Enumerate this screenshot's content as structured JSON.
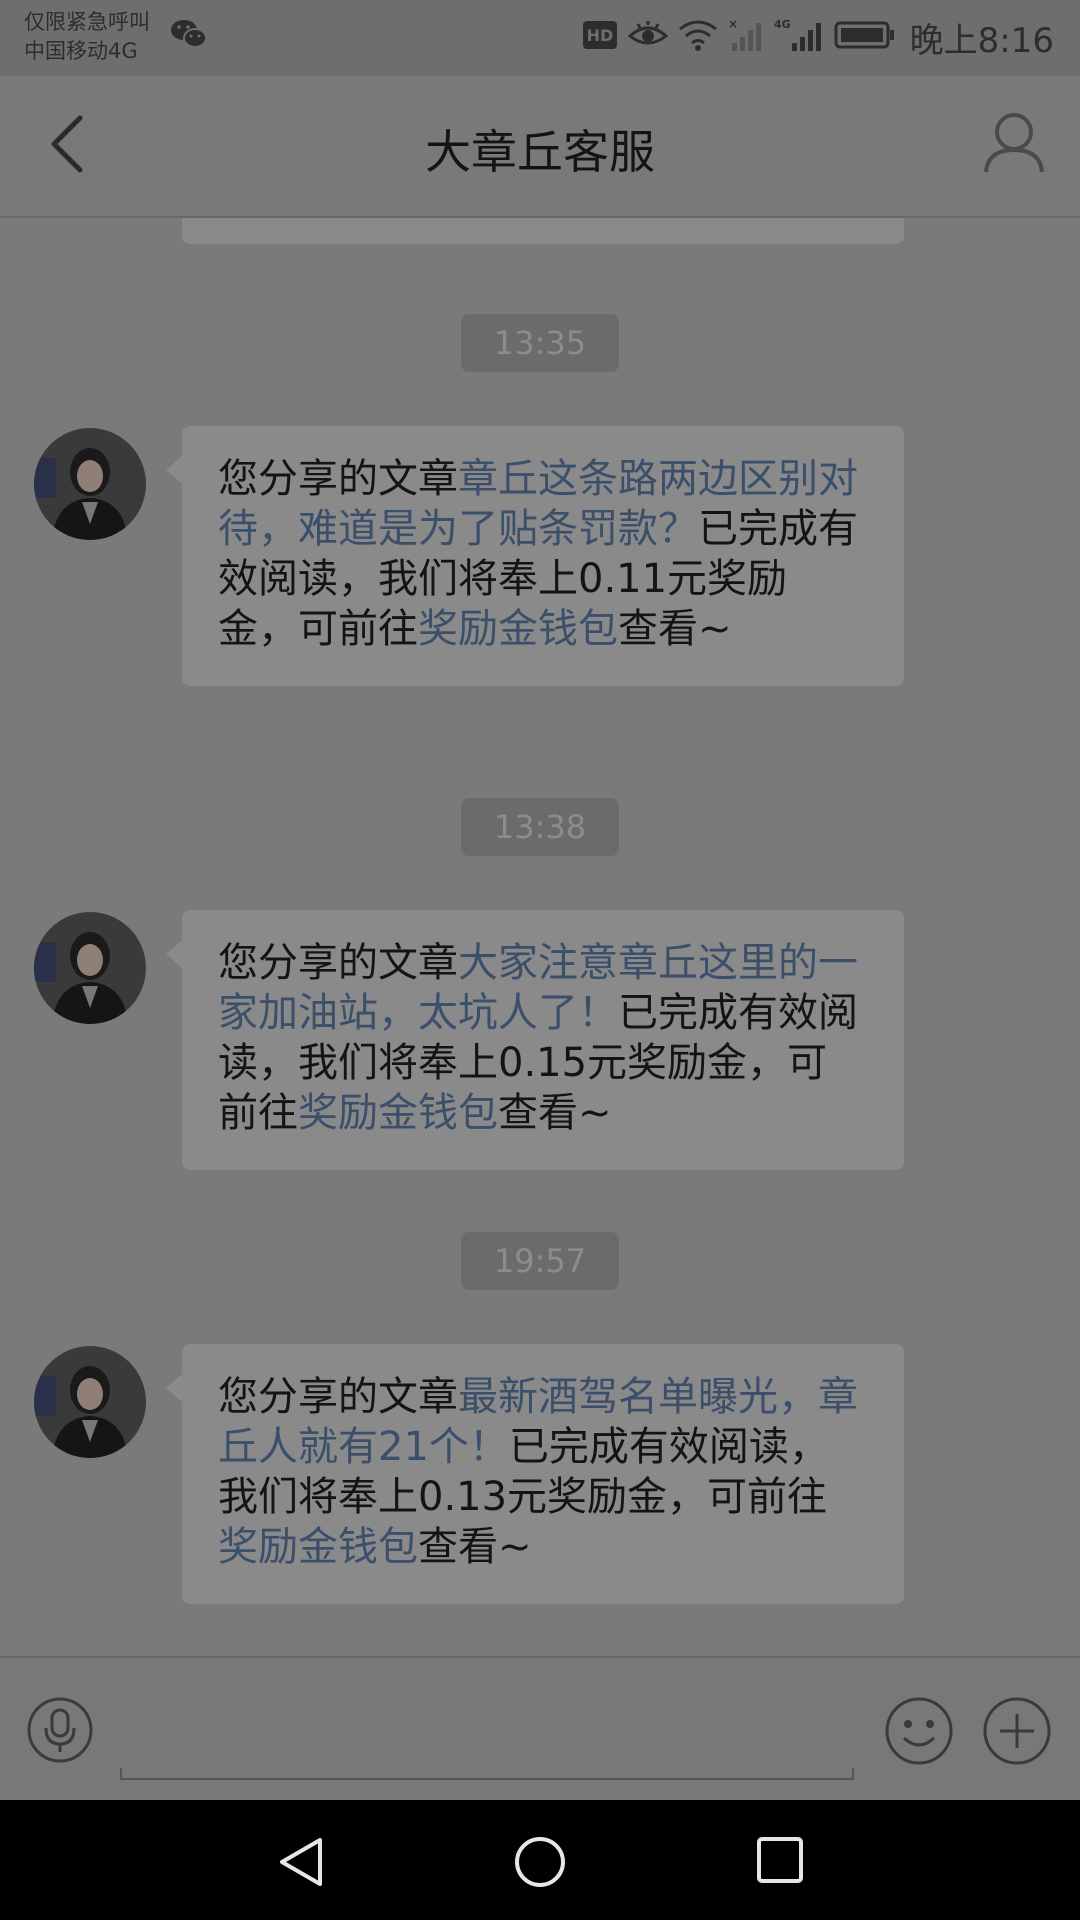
{
  "status_bar": {
    "carrier_line1": "仅限紧急呼叫",
    "carrier_line2": "中国移动4G",
    "hd_badge": "HD",
    "network_label": "4G",
    "time": "晚上8:16",
    "icons": [
      "wechat-icon",
      "hd-icon",
      "eye-icon",
      "wifi-icon",
      "no-signal-icon",
      "signal-icon",
      "battery-icon"
    ]
  },
  "nav": {
    "title": "大章丘客服",
    "back_icon": "chevron-left-icon",
    "profile_icon": "user-icon"
  },
  "messages": [
    {
      "time": "13:35",
      "parts": [
        {
          "text": "您分享的文章",
          "link": false
        },
        {
          "text": "章丘这条路两边区别对待，难道是为了贴条罚款？",
          "link": true
        },
        {
          "text": "已完成有效阅读，我们将奉上0.11元奖励金，可前往",
          "link": false
        },
        {
          "text": "奖励金钱包",
          "link": true
        },
        {
          "text": "查看~",
          "link": false
        }
      ]
    },
    {
      "time": "13:38",
      "parts": [
        {
          "text": "您分享的文章",
          "link": false
        },
        {
          "text": "大家注意章丘这里的一家加油站，太坑人了！",
          "link": true
        },
        {
          "text": "已完成有效阅读，我们将奉上0.15元奖励金，可前往",
          "link": false
        },
        {
          "text": "奖励金钱包",
          "link": true
        },
        {
          "text": "查看~",
          "link": false
        }
      ]
    },
    {
      "time": "19:57",
      "parts": [
        {
          "text": "您分享的文章",
          "link": false
        },
        {
          "text": "最新酒驾名单曝光，章丘人就有21个！",
          "link": true
        },
        {
          "text": "已完成有效阅读，我们将奉上0.13元奖励金，可前往",
          "link": false
        },
        {
          "text": "奖励金钱包",
          "link": true
        },
        {
          "text": "查看~",
          "link": false
        }
      ]
    }
  ],
  "input_bar": {
    "icons": [
      "microphone-icon",
      "emoji-icon",
      "plus-icon"
    ],
    "input_value": ""
  },
  "system_nav": {
    "icons": [
      "nav-back-icon",
      "nav-home-icon",
      "nav-recents-icon"
    ]
  }
}
